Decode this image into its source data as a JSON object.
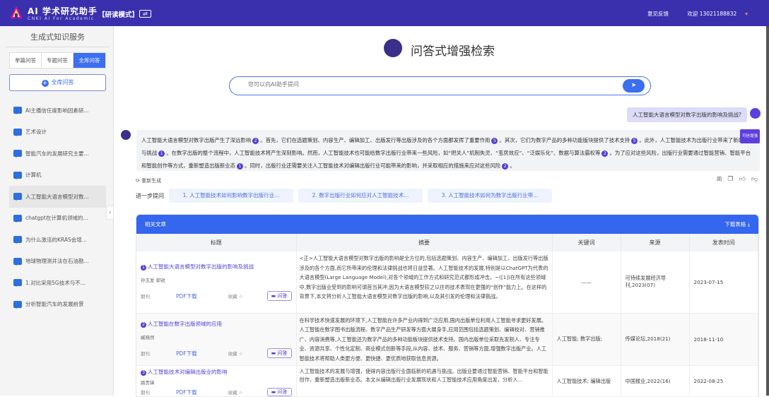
{
  "header": {
    "app_title": "AI 学术研究助手",
    "app_subtitle": "CNKI AI For Academic",
    "mode": "【研读模式】",
    "swap_icon": "⇄",
    "feedback": "意见反馈",
    "welcome": "欢迎 13021188832",
    "caret": "▾"
  },
  "sidebar": {
    "title": "生成式知识服务",
    "tabs": [
      {
        "label": "单篇问答"
      },
      {
        "label": "专题问答"
      },
      {
        "label": "全库问答"
      }
    ],
    "new_button": "全库问答",
    "collapse": "‹",
    "items": [
      {
        "label": "AI主播信任度影响因素研..."
      },
      {
        "label": "艺术设计"
      },
      {
        "label": "智能汽车的发展研究主要..."
      },
      {
        "label": "计算机"
      },
      {
        "label": "人工智能大语言模型对数..."
      },
      {
        "label": "chatgpt在计算机领域的..."
      },
      {
        "label": "为什么激活的KRAS会增..."
      },
      {
        "label": "地球物理测井法在石油勘..."
      },
      {
        "label": "1.对比采用5G技术与不..."
      },
      {
        "label": "分析智能汽车的发展前景"
      }
    ]
  },
  "main": {
    "title": "问答式增强检索",
    "search_placeholder": "您可以向AI助手提问",
    "send": "➤",
    "user_question": "人工智能大语言模型对数字出版的影响及挑战?",
    "answer": {
      "badge": "可信增强",
      "segments": [
        {
          "text": "人工智能大语言模型对数字出版产生了深远影响",
          "cite": "2"
        },
        {
          "text": "。首先，它们在选题策划、内容生产、编辑加工、出版发行等出版涉及的各个方面都发挥了重要作用",
          "cite": "5"
        },
        {
          "text": "。其次，它们为数字产品的多种功能版块提供了技术支持",
          "cite": "5"
        },
        {
          "text": "。此外，人工智能技术为出版行业带来了新的机遇与挑战",
          "cite": "1"
        },
        {
          "text": "。在数字出版的整个流程中，人工智能技术将产生深刻影响。然而，人工智能技术也可能给数字出版行业带来一些风险，如“把关人”机制失灵、“茧房效应”、“泛娱乐化”、数据与算法霸权等",
          "cite": "2"
        },
        {
          "text": "。为了应对这些风险，出版行业需要通过智能营销、智能平台和智能创作等方式，重新塑造出版新业态",
          "cite": "1"
        },
        {
          "text": "。同时，出版行业还需要关注人工智能技术对编辑出版行业可能带来的影响，并采取相应的措施来应对这些风险",
          "cite": "2"
        },
        {
          "text": "。",
          "cite": null
        }
      ]
    },
    "regenerate": "重新生成",
    "further_label": "进一步提问",
    "suggestions": [
      {
        "label": "1. 人工智能技术如何影响数字出版行业..."
      },
      {
        "label": "2. 数字出版行业如何应对人工智能技术..."
      },
      {
        "label": "3. 人工智能技术如何为数字出版行业带..."
      }
    ]
  },
  "articles": {
    "title": "相关文章",
    "download": "下载表格",
    "columns": [
      "标题",
      "摘要",
      "关键词",
      "来源",
      "发表时间"
    ],
    "rows": [
      {
        "num": "1",
        "title": "人工智能大语言模型对数字出版的影响及挑战",
        "authors": "孙玉发 郭锐",
        "type": "期刊",
        "pdf": "PDF下载",
        "fav": "收藏",
        "qa": "问答",
        "abstract": "<正>人工智能大语言模型对数字出版的影响是全方位的,包括选题策划、内容生产、编辑加工、出版发行等出版涉及的各个方面,而它所带来的伦理和法律挑战也将日益显著。人工智能技术的发展,特别是以ChatGPT为代表的大语言模型(Large Language Model),对各个领域的工作方式和研究范式都形成冲击。~([1])在所有这些领域中,数字出版业受到的影响可谓首当其冲,因为大语言模型较之以往的技术表现在更强的“创作”能力上。在这样的背景下,本文将分析人工智能大语言模型对数字出版的影响,以及其引发的伦理和法律挑战。",
        "keywords": "——",
        "source": "可持续发展经济导刊,2023(07)",
        "date": "2023-07-15"
      },
      {
        "num": "2",
        "title": "人工智能在数字出版领域的应用",
        "authors": "臧晓然",
        "type": "期刊",
        "pdf": "PDF下载",
        "fav": "收藏",
        "qa": "问答",
        "abstract": "在科学技术快速发展的环境下,人工智能在许多产业内得到广泛应用,国内出版单位利用人工智能寻求更好发展。人工智能在数字图书出版流程、数字产品生产研发等方面大展身手,应用范围包括选题策划、编辑校对、营销推广、内容消费等,人工智能还为数字产品的多种功能板块提供技术支持。国内出版单位采取先发制人、专注专业、资源共享、个性化定制、商业模式创新等手段,从内容、技术、服务、营销等方面,增强数字出版产业。人工智能技术将帮助人类更方便、更快捷、更优质地获取信息资源。",
        "keywords": "人工智能; 数字出版;",
        "source": "传媒论坛,2018(21)",
        "date": "2018-11-10"
      },
      {
        "num": "3",
        "title": "人工智能技术对编辑出版业的影响",
        "authors": "路贵锋",
        "type": "期刊",
        "pdf": "PDF下载",
        "fav": "收藏",
        "qa": "问答",
        "abstract": "人工智能技术的发展与增强，使得内容出版行业面临新的机遇与挑战。出版业要通过智能营销、智能平台和智能创作，重新塑造出版新业态。本文从编辑出版行业发展现状和人工智能技术应用角度出发，分析人...",
        "keywords": "人工智能技术; 编辑出版",
        "source": "中国报业,2022(16)",
        "date": "2022-08-25"
      }
    ]
  }
}
